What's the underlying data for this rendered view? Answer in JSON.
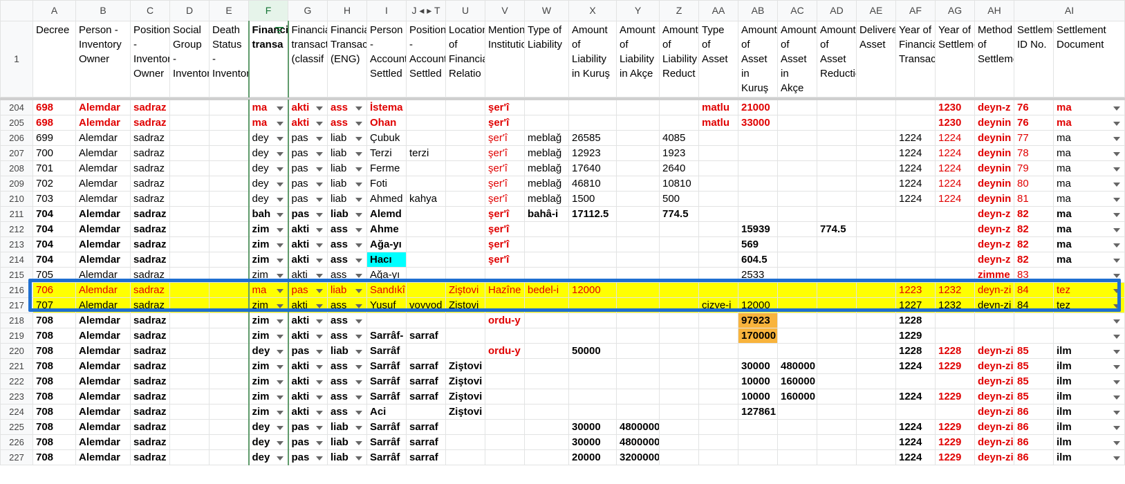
{
  "columns": [
    "A",
    "B",
    "C",
    "D",
    "E",
    "F",
    "G",
    "H",
    "I",
    "J ◂ ▸ T",
    "U",
    "V",
    "W",
    "X",
    "Y",
    "Z",
    "AA",
    "AB",
    "AC",
    "AD",
    "AE",
    "AF",
    "AG",
    "AH",
    "AI"
  ],
  "header_row_number": "1",
  "headers": [
    "Decree",
    "Person - Inventory Owner",
    "Position - Inventory Owner",
    "Social Group - Inventory",
    "Death Status - Inventory",
    "Financial transa",
    "Financial transaction (classif",
    "Financial Transaction (ENG)",
    "Person - Account Settled",
    "Position - Account Settled",
    "Location of Financial Relatio",
    "Mentioned Institution",
    "Type of Liability",
    "Amount of Liability in Kuruş",
    "Amount of Liability in Akçe",
    "Amount of Liability Reduct",
    "Type of Asset",
    "Amount of Asset in Kuruş",
    "Amount of Asset in Akçe",
    "Amount of Asset Reduction",
    "Delivered Asset",
    "Year of Financial Transaction",
    "Year of Settlement",
    "Method of Settlement",
    "Settlement ID No.",
    "Settlement Document"
  ],
  "rows": [
    {
      "n": "204",
      "style": "red-bold",
      "c": [
        "698",
        "Alemdar",
        "sadraz",
        "",
        "",
        "ma",
        "akti",
        "ass",
        "İstema",
        "",
        "",
        "şer'î",
        "",
        "",
        "",
        "",
        "matlu",
        "21000",
        "",
        "",
        "",
        "",
        "1230",
        "deyn-z",
        "76",
        "ma"
      ]
    },
    {
      "n": "205",
      "style": "red-bold",
      "c": [
        "698",
        "Alemdar",
        "sadraz",
        "",
        "",
        "ma",
        "akti",
        "ass",
        "Ohan",
        "",
        "",
        "şer'î",
        "",
        "",
        "",
        "",
        "matlu",
        "33000",
        "",
        "",
        "",
        "",
        "1230",
        "deynin",
        "76",
        "ma"
      ]
    },
    {
      "n": "206",
      "style": "normal",
      "c": [
        "699",
        "Alemdar",
        "sadraz",
        "",
        "",
        "dey",
        "pas",
        "liab",
        "Çubuk",
        "",
        "",
        "şer'î",
        "meblağ",
        "26585",
        "",
        "4085",
        "",
        "",
        "",
        "",
        "",
        "1224",
        "1224",
        "deynin",
        "77",
        "ma"
      ]
    },
    {
      "n": "207",
      "style": "normal",
      "c": [
        "700",
        "Alemdar",
        "sadraz",
        "",
        "",
        "dey",
        "pas",
        "liab",
        "Terzi",
        "terzi",
        "",
        "şer'î",
        "meblağ",
        "12923",
        "",
        "1923",
        "",
        "",
        "",
        "",
        "",
        "1224",
        "1224",
        "deynin",
        "78",
        "ma"
      ]
    },
    {
      "n": "208",
      "style": "normal",
      "c": [
        "701",
        "Alemdar",
        "sadraz",
        "",
        "",
        "dey",
        "pas",
        "liab",
        "Ferme",
        "",
        "",
        "şer'î",
        "meblağ",
        "17640",
        "",
        "2640",
        "",
        "",
        "",
        "",
        "",
        "1224",
        "1224",
        "deynin",
        "79",
        "ma"
      ]
    },
    {
      "n": "209",
      "style": "normal",
      "c": [
        "702",
        "Alemdar",
        "sadraz",
        "",
        "",
        "dey",
        "pas",
        "liab",
        "Foti",
        "",
        "",
        "şer'î",
        "meblağ",
        "46810",
        "",
        "10810",
        "",
        "",
        "",
        "",
        "",
        "1224",
        "1224",
        "deynin",
        "80",
        "ma"
      ]
    },
    {
      "n": "210",
      "style": "normal",
      "c": [
        "703",
        "Alemdar",
        "sadraz",
        "",
        "",
        "dey",
        "pas",
        "liab",
        "Ahmed",
        "kahya",
        "",
        "şer'î",
        "meblağ",
        "1500",
        "",
        "500",
        "",
        "",
        "",
        "",
        "",
        "1224",
        "1224",
        "deynin",
        "81",
        "ma"
      ]
    },
    {
      "n": "211",
      "style": "bold",
      "c": [
        "704",
        "Alemdar",
        "sadraz",
        "",
        "",
        "bah",
        "pas",
        "liab",
        "Alemd",
        "",
        "",
        "şer'î",
        "bahâ-i",
        "17112.5",
        "",
        "774.5",
        "",
        "",
        "",
        "",
        "",
        "",
        "",
        "deyn-z",
        "82",
        "ma"
      ]
    },
    {
      "n": "212",
      "style": "bold",
      "c": [
        "704",
        "Alemdar",
        "sadraz",
        "",
        "",
        "zim",
        "akti",
        "ass",
        "Ahme",
        "",
        "",
        "şer'î",
        "",
        "",
        "",
        "",
        "",
        "15939",
        "",
        "774.5",
        "",
        "",
        "",
        "deyn-z",
        "82",
        "ma"
      ]
    },
    {
      "n": "213",
      "style": "bold",
      "c": [
        "704",
        "Alemdar",
        "sadraz",
        "",
        "",
        "zim",
        "akti",
        "ass",
        "Ağa-yı",
        "",
        "",
        "şer'î",
        "",
        "",
        "",
        "",
        "",
        "569",
        "",
        "",
        "",
        "",
        "",
        "deyn-z",
        "82",
        "ma"
      ]
    },
    {
      "n": "214",
      "style": "bold",
      "c": [
        "704",
        "Alemdar",
        "sadraz",
        "",
        "",
        "zim",
        "akti",
        "ass",
        "Hacı",
        "",
        "",
        "şer'î",
        "",
        "",
        "",
        "",
        "",
        "604.5",
        "",
        "",
        "",
        "",
        "",
        "deyn-z",
        "82",
        "ma"
      ]
    },
    {
      "n": "215",
      "style": "normal",
      "c": [
        "705",
        "Alemdar",
        "sadraz",
        "",
        "",
        "zim",
        "akti",
        "ass",
        "Ağa-yı",
        "",
        "",
        "",
        "",
        "",
        "",
        "",
        "",
        "2533",
        "",
        "",
        "",
        "",
        "",
        "zimme",
        "83",
        ""
      ]
    },
    {
      "n": "216",
      "style": "yellow-red",
      "c": [
        "706",
        "Alemdar",
        "sadraz",
        "",
        "",
        "ma",
        "pas",
        "liab",
        "Sandıkî",
        "",
        "Ziştovi",
        "Hazîne",
        "bedel-i",
        "12000",
        "",
        "",
        "",
        "",
        "",
        "",
        "",
        "1223",
        "1232",
        "deyn-zi",
        "84",
        "tez"
      ]
    },
    {
      "n": "217",
      "style": "yellow",
      "c": [
        "707",
        "Alemdar",
        "sadraz",
        "",
        "",
        "zim",
        "akti",
        "ass",
        "Yusuf",
        "voyvod",
        "Ziştovi",
        "",
        "",
        "",
        "",
        "",
        "cizye-i",
        "12000",
        "",
        "",
        "",
        "1227",
        "1232",
        "deyn-zi",
        "84",
        "tez"
      ]
    },
    {
      "n": "218",
      "style": "bold",
      "c": [
        "708",
        "Alemdar",
        "sadraz",
        "",
        "",
        "zim",
        "akti",
        "ass",
        "",
        "",
        "",
        "ordu-y",
        "",
        "",
        "",
        "",
        "",
        "97923",
        "",
        "",
        "",
        "1228",
        "",
        "",
        "",
        ""
      ]
    },
    {
      "n": "219",
      "style": "bold",
      "c": [
        "708",
        "Alemdar",
        "sadraz",
        "",
        "",
        "zim",
        "akti",
        "ass",
        "Sarrâf-",
        "sarraf",
        "",
        "",
        "",
        "",
        "",
        "",
        "",
        "170000",
        "",
        "",
        "",
        "1229",
        "",
        "",
        "",
        ""
      ]
    },
    {
      "n": "220",
      "style": "bold",
      "c": [
        "708",
        "Alemdar",
        "sadraz",
        "",
        "",
        "dey",
        "pas",
        "liab",
        "Sarrâf",
        "",
        "",
        "ordu-y",
        "",
        "50000",
        "",
        "",
        "",
        "",
        "",
        "",
        "",
        "1228",
        "1228",
        "deyn-zi",
        "85",
        "ilm"
      ]
    },
    {
      "n": "221",
      "style": "bold",
      "c": [
        "708",
        "Alemdar",
        "sadraz",
        "",
        "",
        "zim",
        "akti",
        "ass",
        "Sarrâf",
        "sarraf",
        "Ziştovi",
        "",
        "",
        "",
        "",
        "",
        "",
        "30000",
        "480000",
        "",
        "",
        "1224",
        "1229",
        "deyn-zi",
        "85",
        "ilm"
      ]
    },
    {
      "n": "222",
      "style": "bold",
      "c": [
        "708",
        "Alemdar",
        "sadraz",
        "",
        "",
        "zim",
        "akti",
        "ass",
        "Sarrâf",
        "sarraf",
        "Ziştovi",
        "",
        "",
        "",
        "",
        "",
        "",
        "10000",
        "160000",
        "",
        "",
        "",
        "",
        "deyn-zi",
        "85",
        "ilm"
      ]
    },
    {
      "n": "223",
      "style": "bold",
      "c": [
        "708",
        "Alemdar",
        "sadraz",
        "",
        "",
        "zim",
        "akti",
        "ass",
        "Sarrâf",
        "sarraf",
        "Ziştovi",
        "",
        "",
        "",
        "",
        "",
        "",
        "10000",
        "160000",
        "",
        "",
        "1224",
        "1229",
        "deyn-zi",
        "85",
        "ilm"
      ]
    },
    {
      "n": "224",
      "style": "bold",
      "c": [
        "708",
        "Alemdar",
        "sadraz",
        "",
        "",
        "zim",
        "akti",
        "ass",
        "Aci",
        "",
        "Ziştovi",
        "",
        "",
        "",
        "",
        "",
        "",
        "127861",
        "",
        "",
        "",
        "",
        "",
        "deyn-zi",
        "86",
        "ilm"
      ]
    },
    {
      "n": "225",
      "style": "bold",
      "c": [
        "708",
        "Alemdar",
        "sadraz",
        "",
        "",
        "dey",
        "pas",
        "liab",
        "Sarrâf",
        "sarraf",
        "",
        "",
        "",
        "30000",
        "4800000",
        "",
        "",
        "",
        "",
        "",
        "",
        "1224",
        "1229",
        "deyn-zi",
        "86",
        "ilm"
      ]
    },
    {
      "n": "226",
      "style": "bold",
      "c": [
        "708",
        "Alemdar",
        "sadraz",
        "",
        "",
        "dey",
        "pas",
        "liab",
        "Sarrâf",
        "sarraf",
        "",
        "",
        "",
        "30000",
        "4800000",
        "",
        "",
        "",
        "",
        "",
        "",
        "1224",
        "1229",
        "deyn-zi",
        "86",
        "ilm"
      ]
    },
    {
      "n": "227",
      "style": "bold",
      "c": [
        "708",
        "Alemdar",
        "sadraz",
        "",
        "",
        "dey",
        "pas",
        "liab",
        "Sarrâf",
        "sarraf",
        "",
        "",
        "",
        "20000",
        "3200000",
        "",
        "",
        "",
        "",
        "",
        "",
        "1224",
        "1229",
        "deyn-zi",
        "86",
        "ilm"
      ]
    }
  ],
  "colors": {
    "highlight_yellow": "#ffff00",
    "red_text": "#e00000",
    "cyan_fill": "#00ffff",
    "orange_fill": "#f9b43c",
    "selection_box": "#1e6fd1"
  }
}
